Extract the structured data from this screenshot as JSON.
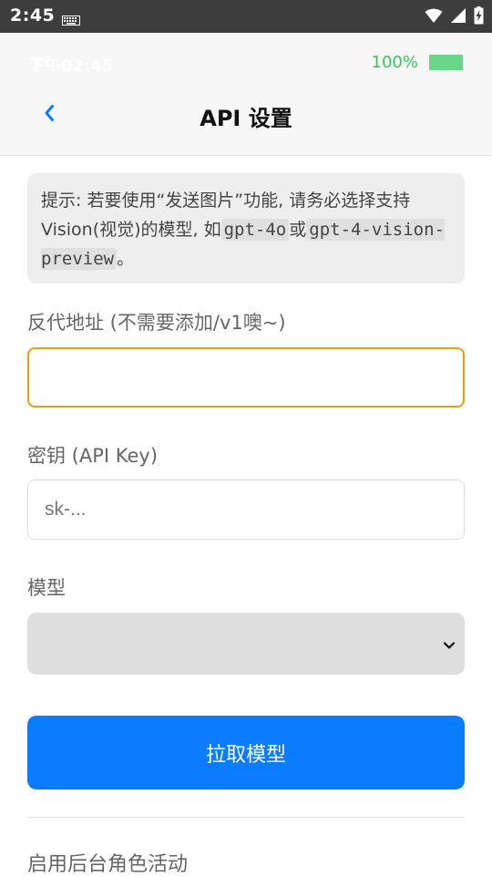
{
  "system_bar": {
    "time": "2:45",
    "icons": [
      "keyboard-icon",
      "wifi-icon",
      "signal-icon",
      "battery-charging-icon"
    ]
  },
  "header": {
    "app_time": "下午02:45",
    "battery_percent": "100%",
    "battery_level": 1.0,
    "back_icon": "chevron-left-icon",
    "title": "API 设置",
    "accent_color": "#0a7cff",
    "battery_color": "#2ecc55"
  },
  "hint": {
    "prefix": "提示: 若要使用“发送图片”功能, 请务必选择支持Vision(视觉)的模型, 如",
    "model_a": "gpt-4o",
    "or": "或",
    "model_b": "gpt-4-vision-preview",
    "suffix": "。"
  },
  "form": {
    "proxy_label": "反代地址 (不需要添加/v1噢~)",
    "proxy_value": "",
    "key_label": "密钥 (API Key)",
    "key_placeholder": "sk-...",
    "model_label": "模型",
    "model_selected": "",
    "fetch_button": "拉取模型",
    "background_label": "启用后台角色活动"
  }
}
